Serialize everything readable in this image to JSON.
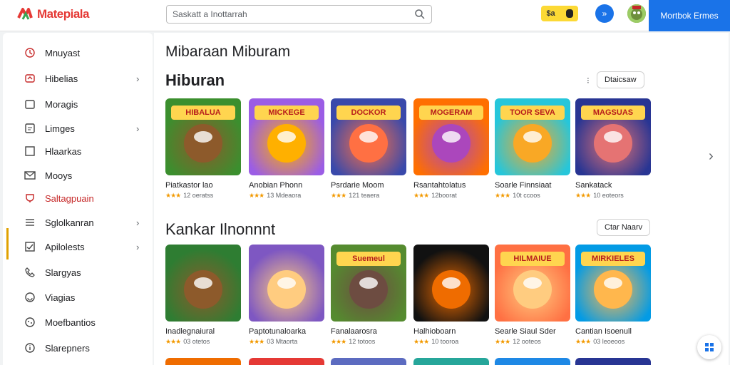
{
  "app": {
    "logo_text": "Matepiala",
    "search_placeholder": "Saskatt a Inottarrah",
    "coin_label": "$a",
    "round_btn_icon": "chevron-double-right-icon",
    "cta_label": "Mortbok Ermes"
  },
  "sidebar": {
    "items": [
      {
        "label": "Mnuyast",
        "icon": "clock-icon",
        "chevron": false
      },
      {
        "label": "Hibelias",
        "icon": "tag-icon",
        "chevron": true
      },
      {
        "label": "Moragis",
        "icon": "folder-icon",
        "chevron": false
      },
      {
        "label": "Limges",
        "icon": "image-icon",
        "chevron": true
      },
      {
        "label": "Hlaarkas",
        "icon": "bookmark-icon",
        "chevron": false
      },
      {
        "label": "Mooys",
        "icon": "mail-icon",
        "chevron": false
      },
      {
        "label": "Saltagpuain",
        "icon": "trophy-icon",
        "chevron": false
      },
      {
        "label": "Sglolkanran",
        "icon": "menu-icon",
        "chevron": true
      },
      {
        "label": "Apilolests",
        "icon": "checklist-icon",
        "chevron": true
      },
      {
        "label": "Slargyas",
        "icon": "phone-icon",
        "chevron": false
      },
      {
        "label": "Viagias",
        "icon": "smile-icon",
        "chevron": false
      },
      {
        "label": "Moefbantios",
        "icon": "gamepad-icon",
        "chevron": false
      },
      {
        "label": "Slarepners",
        "icon": "info-icon",
        "chevron": false
      }
    ]
  },
  "main": {
    "page_title": "Mibaraan Miburam",
    "section1": {
      "title": "Hiburan",
      "pill_label": "Dtaicsaw",
      "cards": [
        {
          "title": "Piatkastor lao",
          "meta": "12 oeratss",
          "banner": "HIBALUA",
          "bg": "#3b8f2e",
          "accent": "#8d5a2b"
        },
        {
          "title": "Anobian Phonn",
          "meta": "13 Mdeaora",
          "banner": "MICKEGE",
          "bg": "#9b5de5",
          "accent": "#ffb000"
        },
        {
          "title": "Psrdarie Moom",
          "meta": "121 teaera",
          "banner": "DOCKOR",
          "bg": "#3949ab",
          "accent": "#ff7043"
        },
        {
          "title": "Rsantahtolatus",
          "meta": "12boorat",
          "banner": "MOGERAM",
          "bg": "#ff6f00",
          "accent": "#ab47bc"
        },
        {
          "title": "Soarle Finnsiaat",
          "meta": "10t ccoos",
          "banner": "TOOR SEVA",
          "bg": "#26c6da",
          "accent": "#f9a825"
        },
        {
          "title": "Sankatack",
          "meta": "10 eoteors",
          "banner": "MAGSUAS",
          "bg": "#283593",
          "accent": "#e57373"
        }
      ]
    },
    "section2": {
      "title": "Kankar Ilnonnnt",
      "pill_label": "Ctar Naarv",
      "cards": [
        {
          "title": "Inadlegnaiural",
          "meta": "03 otetos",
          "banner": "",
          "bg": "#2e7d32",
          "accent": "#8d5a2b"
        },
        {
          "title": "Paptotunaloarka",
          "meta": "03 Mtaorta",
          "banner": "",
          "bg": "#7e57c2",
          "accent": "#ffcc80"
        },
        {
          "title": "Fanalaarosra",
          "meta": "12 totoos",
          "banner": "Suemeul",
          "bg": "#558b2f",
          "accent": "#6d4c41"
        },
        {
          "title": "Halhioboarn",
          "meta": "10 tooroa",
          "banner": "",
          "bg": "#111111",
          "accent": "#ef6c00"
        },
        {
          "title": "Searle Siaul Sder",
          "meta": "12 ooteos",
          "banner": "HILMAIUE",
          "bg": "#ff7043",
          "accent": "#ffcc80"
        },
        {
          "title": "Cantian Isoenull",
          "meta": "03 leoeoos",
          "banner": "MIRKIELES",
          "bg": "#039be5",
          "accent": "#ffb74d"
        }
      ]
    },
    "stars": "★★★",
    "fab_icon": "grid-icon"
  }
}
